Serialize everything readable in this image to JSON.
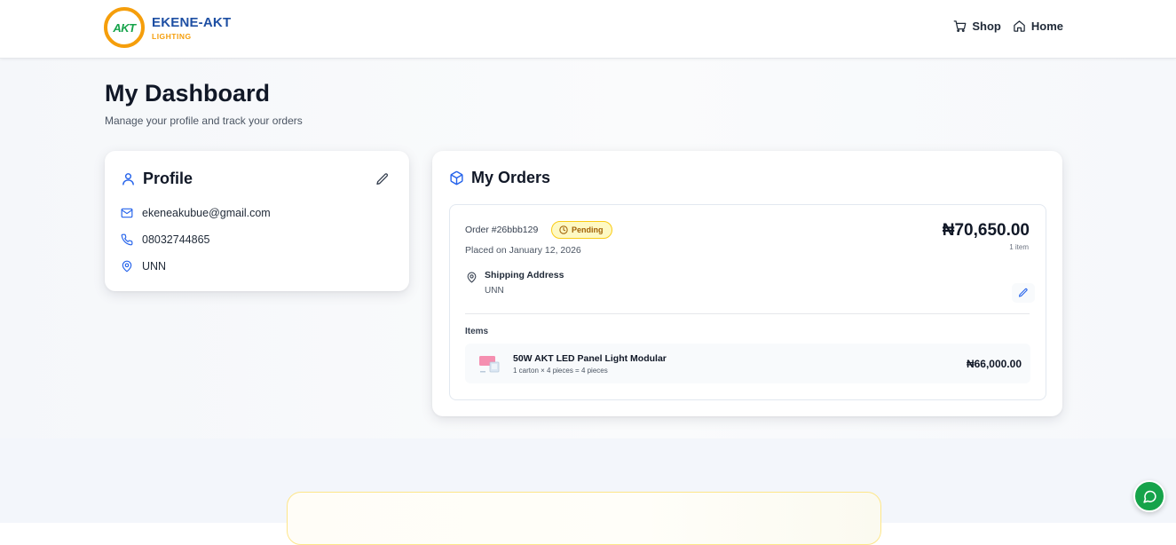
{
  "brand": {
    "mark": "AKT",
    "name": "EKENE-AKT",
    "tagline": "LIGHTING"
  },
  "nav": {
    "shop": "Shop",
    "home": "Home"
  },
  "page": {
    "title": "My Dashboard",
    "subtitle": "Manage your profile and track your orders"
  },
  "profile": {
    "title": "Profile",
    "email": "ekeneakubue@gmail.com",
    "phone": "08032744865",
    "location": "UNN"
  },
  "orders": {
    "title": "My Orders",
    "list": [
      {
        "id": "Order #26bbb129",
        "status": "Pending",
        "placed": "Placed on January 12, 2026",
        "total": "₦70,650.00",
        "item_count": "1 item",
        "shipping_label": "Shipping Address",
        "shipping_value": "UNN",
        "items_label": "Items",
        "items": [
          {
            "name": "50W AKT LED Panel Light Modular",
            "detail": "1 carton × 4 pieces = 4 pieces",
            "price": "₦66,000.00"
          }
        ]
      }
    ]
  },
  "colors": {
    "brand_blue": "#1e4fa3",
    "brand_orange": "#f59e0b",
    "accent_blue": "#2563eb",
    "pending_bg": "#fef9c3",
    "pending_text": "#a16207",
    "chat_green": "#16a34a"
  },
  "icons": {
    "nav": [
      "cart-icon",
      "home-icon"
    ],
    "profile": [
      "user-icon",
      "pencil-icon",
      "mail-icon",
      "phone-icon",
      "map-pin-icon"
    ],
    "orders": [
      "package-icon",
      "clock-icon",
      "map-pin-icon",
      "pencil-icon"
    ],
    "floating": "chat-icon"
  }
}
